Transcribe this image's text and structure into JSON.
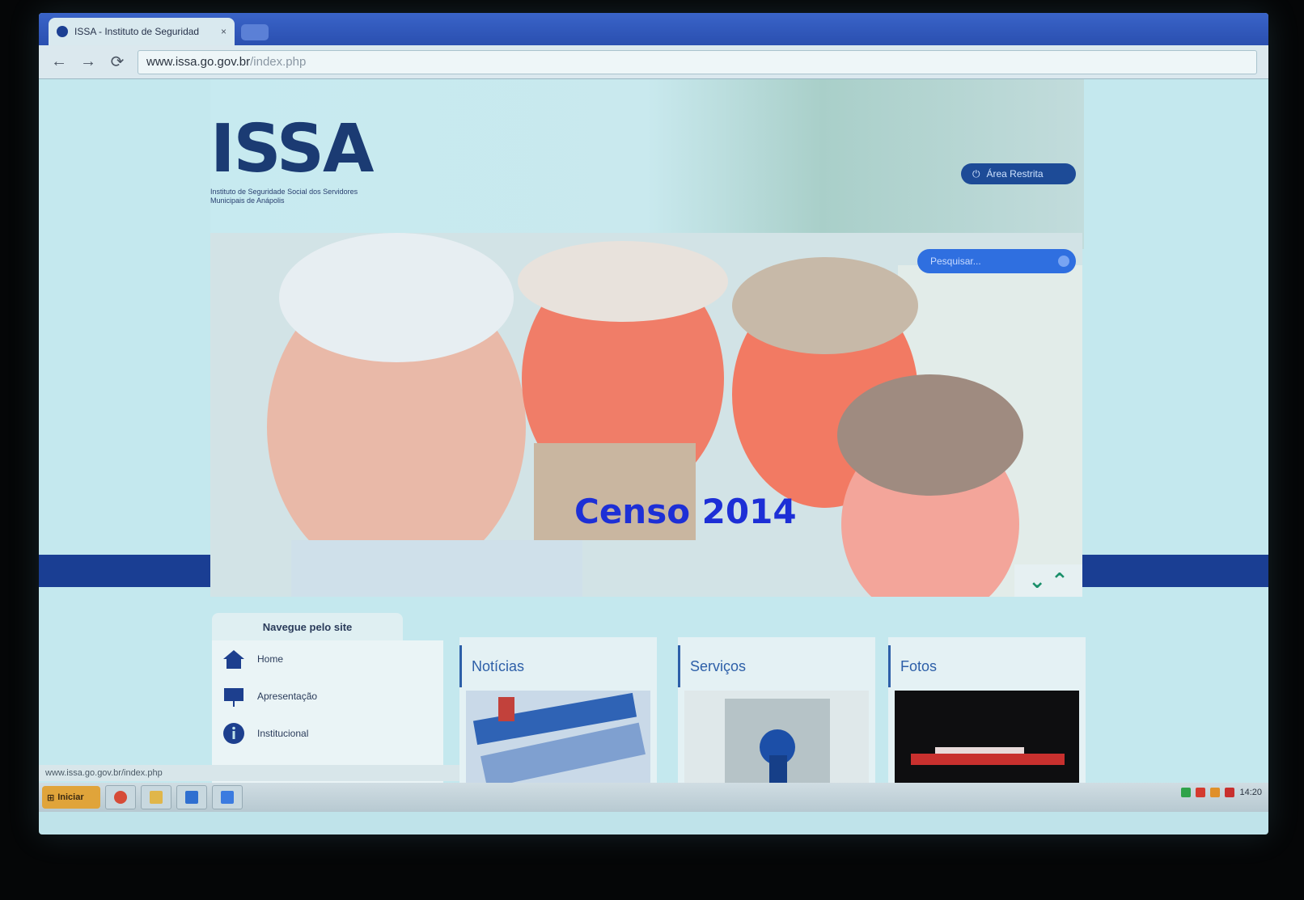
{
  "browser": {
    "tab_title": "ISSA - Instituto de Seguridad",
    "tab_close": "×",
    "url_host": "www.issa.go.gov.br",
    "url_path": "/index.php",
    "back": "←",
    "forward": "→",
    "reload": "⟳"
  },
  "header": {
    "logo": "ISSA",
    "logo_subtitle": "Instituto de Seguridade Social dos Servidores Municipais de Anápolis",
    "restricted_area": "Área Restrita",
    "search_placeholder": "Pesquisar..."
  },
  "banner": {
    "caption": "Censo 2014",
    "prev": "⌄",
    "next": "⌃"
  },
  "nav": {
    "title": "Navegue pelo site",
    "items": [
      {
        "label": "Home",
        "icon": "home-icon"
      },
      {
        "label": "Apresentação",
        "icon": "presentation-icon"
      },
      {
        "label": "Institucional",
        "icon": "info-icon"
      }
    ]
  },
  "cards": [
    {
      "title": "Notícias"
    },
    {
      "title": "Serviços"
    },
    {
      "title": "Fotos"
    }
  ],
  "status_text": "www.issa.go.gov.br/index.php",
  "taskbar": {
    "start": "Iniciar",
    "clock": "14:20"
  },
  "colors": {
    "brand": "#1b3b73",
    "bar": "#1a3e93",
    "caption": "#1d2fd6",
    "search": "#2f6fe0"
  }
}
